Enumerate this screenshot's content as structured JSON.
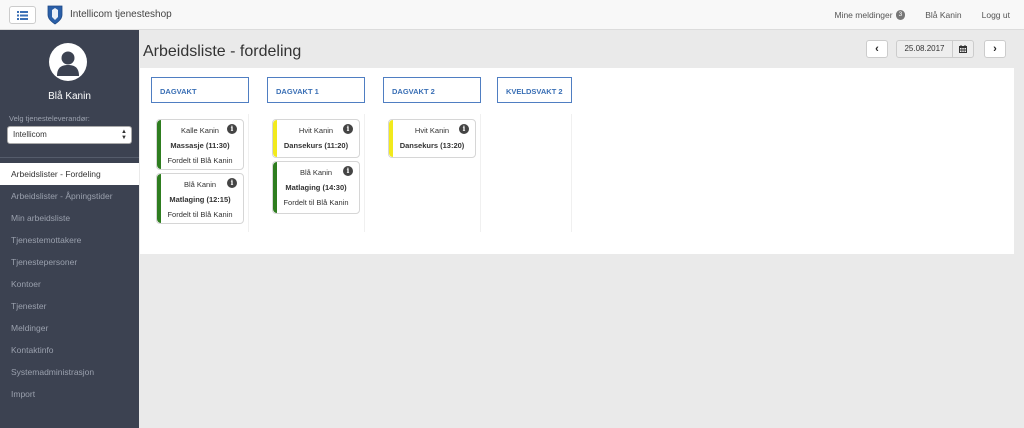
{
  "app": {
    "title": "Intellicom tjenesteshop"
  },
  "topbar": {
    "messages_label": "Mine meldinger",
    "messages_count": "3",
    "user_label": "Blå Kanin",
    "logout_label": "Logg ut"
  },
  "sidebar": {
    "user_name": "Blå Kanin",
    "supplier_label": "Velg tjenesteleverandør:",
    "supplier_value": "Intellicom",
    "items": [
      {
        "label": "Arbeidslister - Fordeling"
      },
      {
        "label": "Arbeidslister - Åpningstider"
      },
      {
        "label": "Min arbeidsliste"
      },
      {
        "label": "Tjenestemottakere"
      },
      {
        "label": "Tjenestepersoner"
      },
      {
        "label": "Kontoer"
      },
      {
        "label": "Tjenester"
      },
      {
        "label": "Meldinger"
      },
      {
        "label": "Kontaktinfo"
      },
      {
        "label": "Systemadministrasjon"
      },
      {
        "label": "Import"
      }
    ]
  },
  "main": {
    "title": "Arbeidsliste - fordeling",
    "date": "25.08.2017",
    "columns": [
      {
        "header": "DAGVAKT",
        "cards": [
          {
            "person": "Kalle Kanin",
            "activity": "Massasje (11:30)",
            "assigned": "Fordelt til Blå Kanin",
            "color": "#2e7d1f"
          },
          {
            "person": "Blå Kanin",
            "activity": "Matlaging (12:15)",
            "assigned": "Fordelt til Blå Kanin",
            "color": "#2e7d1f"
          }
        ]
      },
      {
        "header": "DAGVAKT 1",
        "cards": [
          {
            "person": "Hvit Kanin",
            "activity": "Dansekurs (11:20)",
            "color": "#f2ea1c"
          },
          {
            "person": "Blå Kanin",
            "activity": "Matlaging (14:30)",
            "assigned": "Fordelt til Blå Kanin",
            "color": "#2e7d1f"
          }
        ]
      },
      {
        "header": "DAGVAKT 2",
        "cards": [
          {
            "person": "Hvit Kanin",
            "activity": "Dansekurs (13:20)",
            "color": "#f2ea1c"
          }
        ]
      },
      {
        "header": "KVELDSVAKT 2",
        "cards": []
      }
    ]
  }
}
